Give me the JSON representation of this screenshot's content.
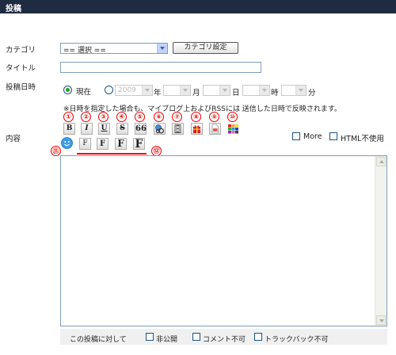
{
  "header": {
    "title": "投稿"
  },
  "category": {
    "label": "カテゴリ",
    "select_value": "== 選択 ==",
    "settings_button": "カテゴリ設定"
  },
  "title_field": {
    "label": "タイトル",
    "value": ""
  },
  "post_date": {
    "label": "投稿日時",
    "now_label": "現在",
    "year_value": "2009",
    "year_unit": "年",
    "month_unit": "月",
    "day_unit": "日",
    "hour_unit": "時",
    "minute_unit": "分",
    "note": "※日時を指定した場合も、マイブログ上およびRSSには 送信した日時で反映されます。"
  },
  "content": {
    "label": "内容",
    "numbers": [
      "①",
      "②",
      "③",
      "④",
      "⑤",
      "⑥",
      "⑦",
      "⑧",
      "⑨",
      "⑩",
      "⑪",
      "⑫"
    ],
    "toolbar": {
      "bold": "B",
      "italic": "I",
      "underline": "U",
      "strike": "S",
      "quote": "66"
    },
    "font_sizes": [
      "F",
      "F",
      "F",
      "F"
    ],
    "more_label": "More",
    "html_label": "HTML不使用",
    "body_text": ""
  },
  "footer": {
    "label": "この投稿に対して",
    "private": "非公開",
    "no_comment": "コメント不可",
    "no_trackback": "トラックバック不可"
  }
}
